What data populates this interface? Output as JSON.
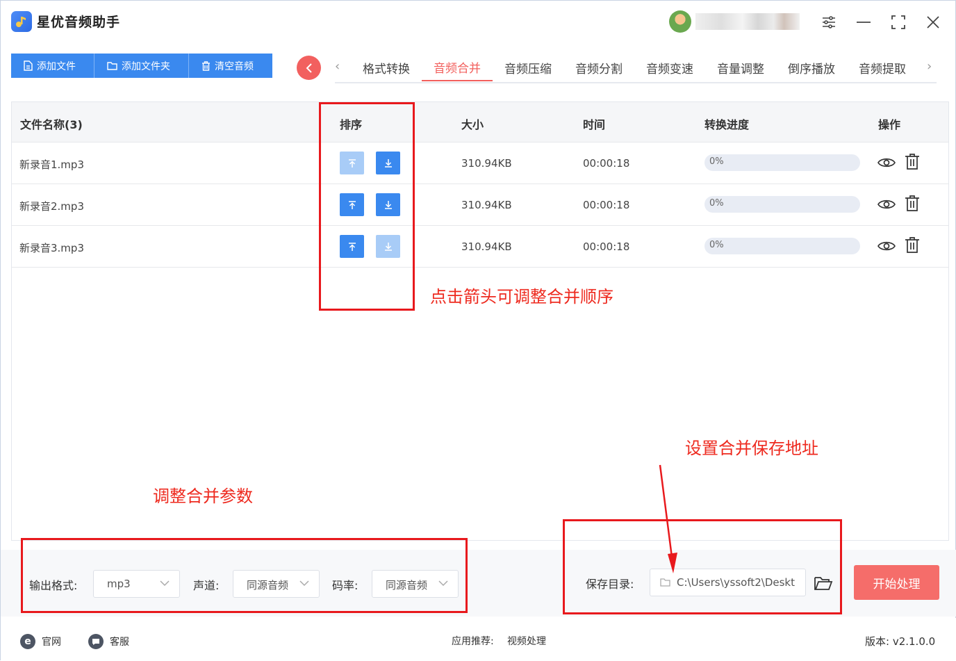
{
  "app": {
    "title": "星优音频助手"
  },
  "toolbar": {
    "add_file": "添加文件",
    "add_folder": "添加文件夹",
    "clear_audio": "清空音频"
  },
  "tabs": [
    "格式转换",
    "音频合并",
    "音频压缩",
    "音频分割",
    "音频变速",
    "音量调整",
    "倒序播放",
    "音频提取"
  ],
  "active_tab": "音频合并",
  "table": {
    "headers": {
      "name": "文件名称(3)",
      "sort": "排序",
      "size": "大小",
      "time": "时间",
      "progress": "转换进度",
      "action": "操作"
    },
    "rows": [
      {
        "name": "新录音1.mp3",
        "size": "310.94KB",
        "time": "00:00:18",
        "progress": "0%",
        "up_enabled": false,
        "down_enabled": true
      },
      {
        "name": "新录音2.mp3",
        "size": "310.94KB",
        "time": "00:00:18",
        "progress": "0%",
        "up_enabled": true,
        "down_enabled": true
      },
      {
        "name": "新录音3.mp3",
        "size": "310.94KB",
        "time": "00:00:18",
        "progress": "0%",
        "up_enabled": true,
        "down_enabled": false
      }
    ]
  },
  "annotations": {
    "sort_hint": "点击箭头可调整合并顺序",
    "save_hint": "设置合并保存地址",
    "params_hint": "调整合并参数"
  },
  "settings": {
    "format_label": "输出格式:",
    "format_value": "mp3",
    "channel_label": "声道:",
    "channel_value": "同源音频",
    "bitrate_label": "码率:",
    "bitrate_value": "同源音频",
    "save_label": "保存目录:",
    "save_path": "C:\\Users\\yssoft2\\Deskt",
    "start_button": "开始处理"
  },
  "statusbar": {
    "website": "官网",
    "service": "客服",
    "recommend_label": "应用推荐:",
    "recommend_value": "视频处理",
    "version": "版本: v2.1.0.0"
  },
  "colors": {
    "primary": "#3a89ef",
    "accent": "#f25f5c",
    "annotation": "#e8191d"
  }
}
